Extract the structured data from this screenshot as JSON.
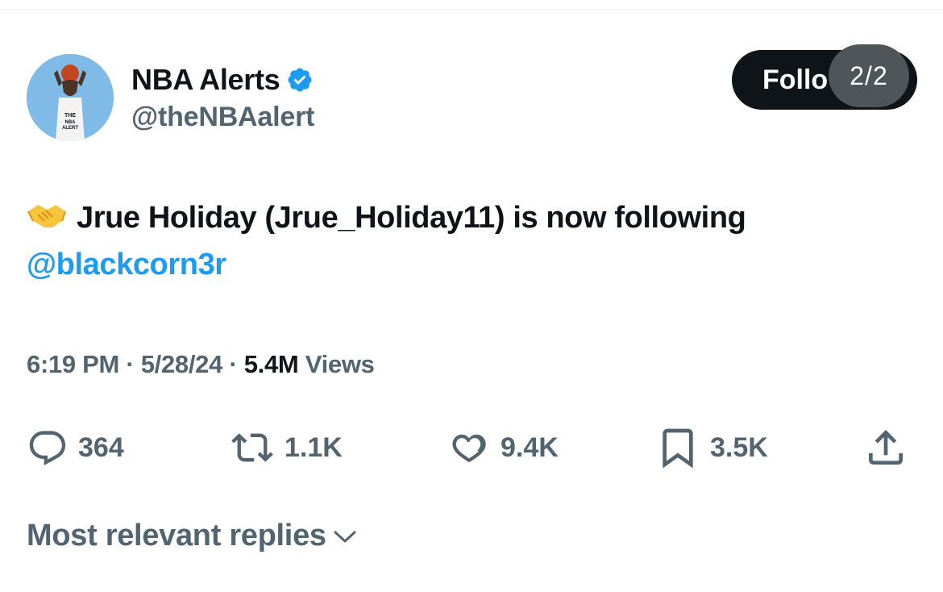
{
  "account": {
    "display_name": "NBA Alerts",
    "handle": "@theNBAalert",
    "verified": true
  },
  "follow_button": {
    "label": "Follo"
  },
  "page_counter": {
    "label": "2/2"
  },
  "tweet": {
    "emoji": "handshake-icon",
    "text": "Jrue Holiday (Jrue_Holiday11) is now following",
    "mention": "@blackcorn3r"
  },
  "meta": {
    "time": "6:19 PM",
    "sep1": " · ",
    "date": "5/28/24",
    "sep2": " · ",
    "views_count": "5.4M",
    "views_label": " Views"
  },
  "actions": {
    "replies": "364",
    "reposts": "1.1K",
    "likes": "9.4K",
    "bookmarks": "3.5K"
  },
  "replies_sort": {
    "label": "Most relevant replies"
  },
  "colors": {
    "accent": "#1d9bf0",
    "text_primary": "#0f1419",
    "text_secondary": "#536471",
    "button_dark": "#0f1419",
    "avatar_bg": "#7fbbe6"
  }
}
